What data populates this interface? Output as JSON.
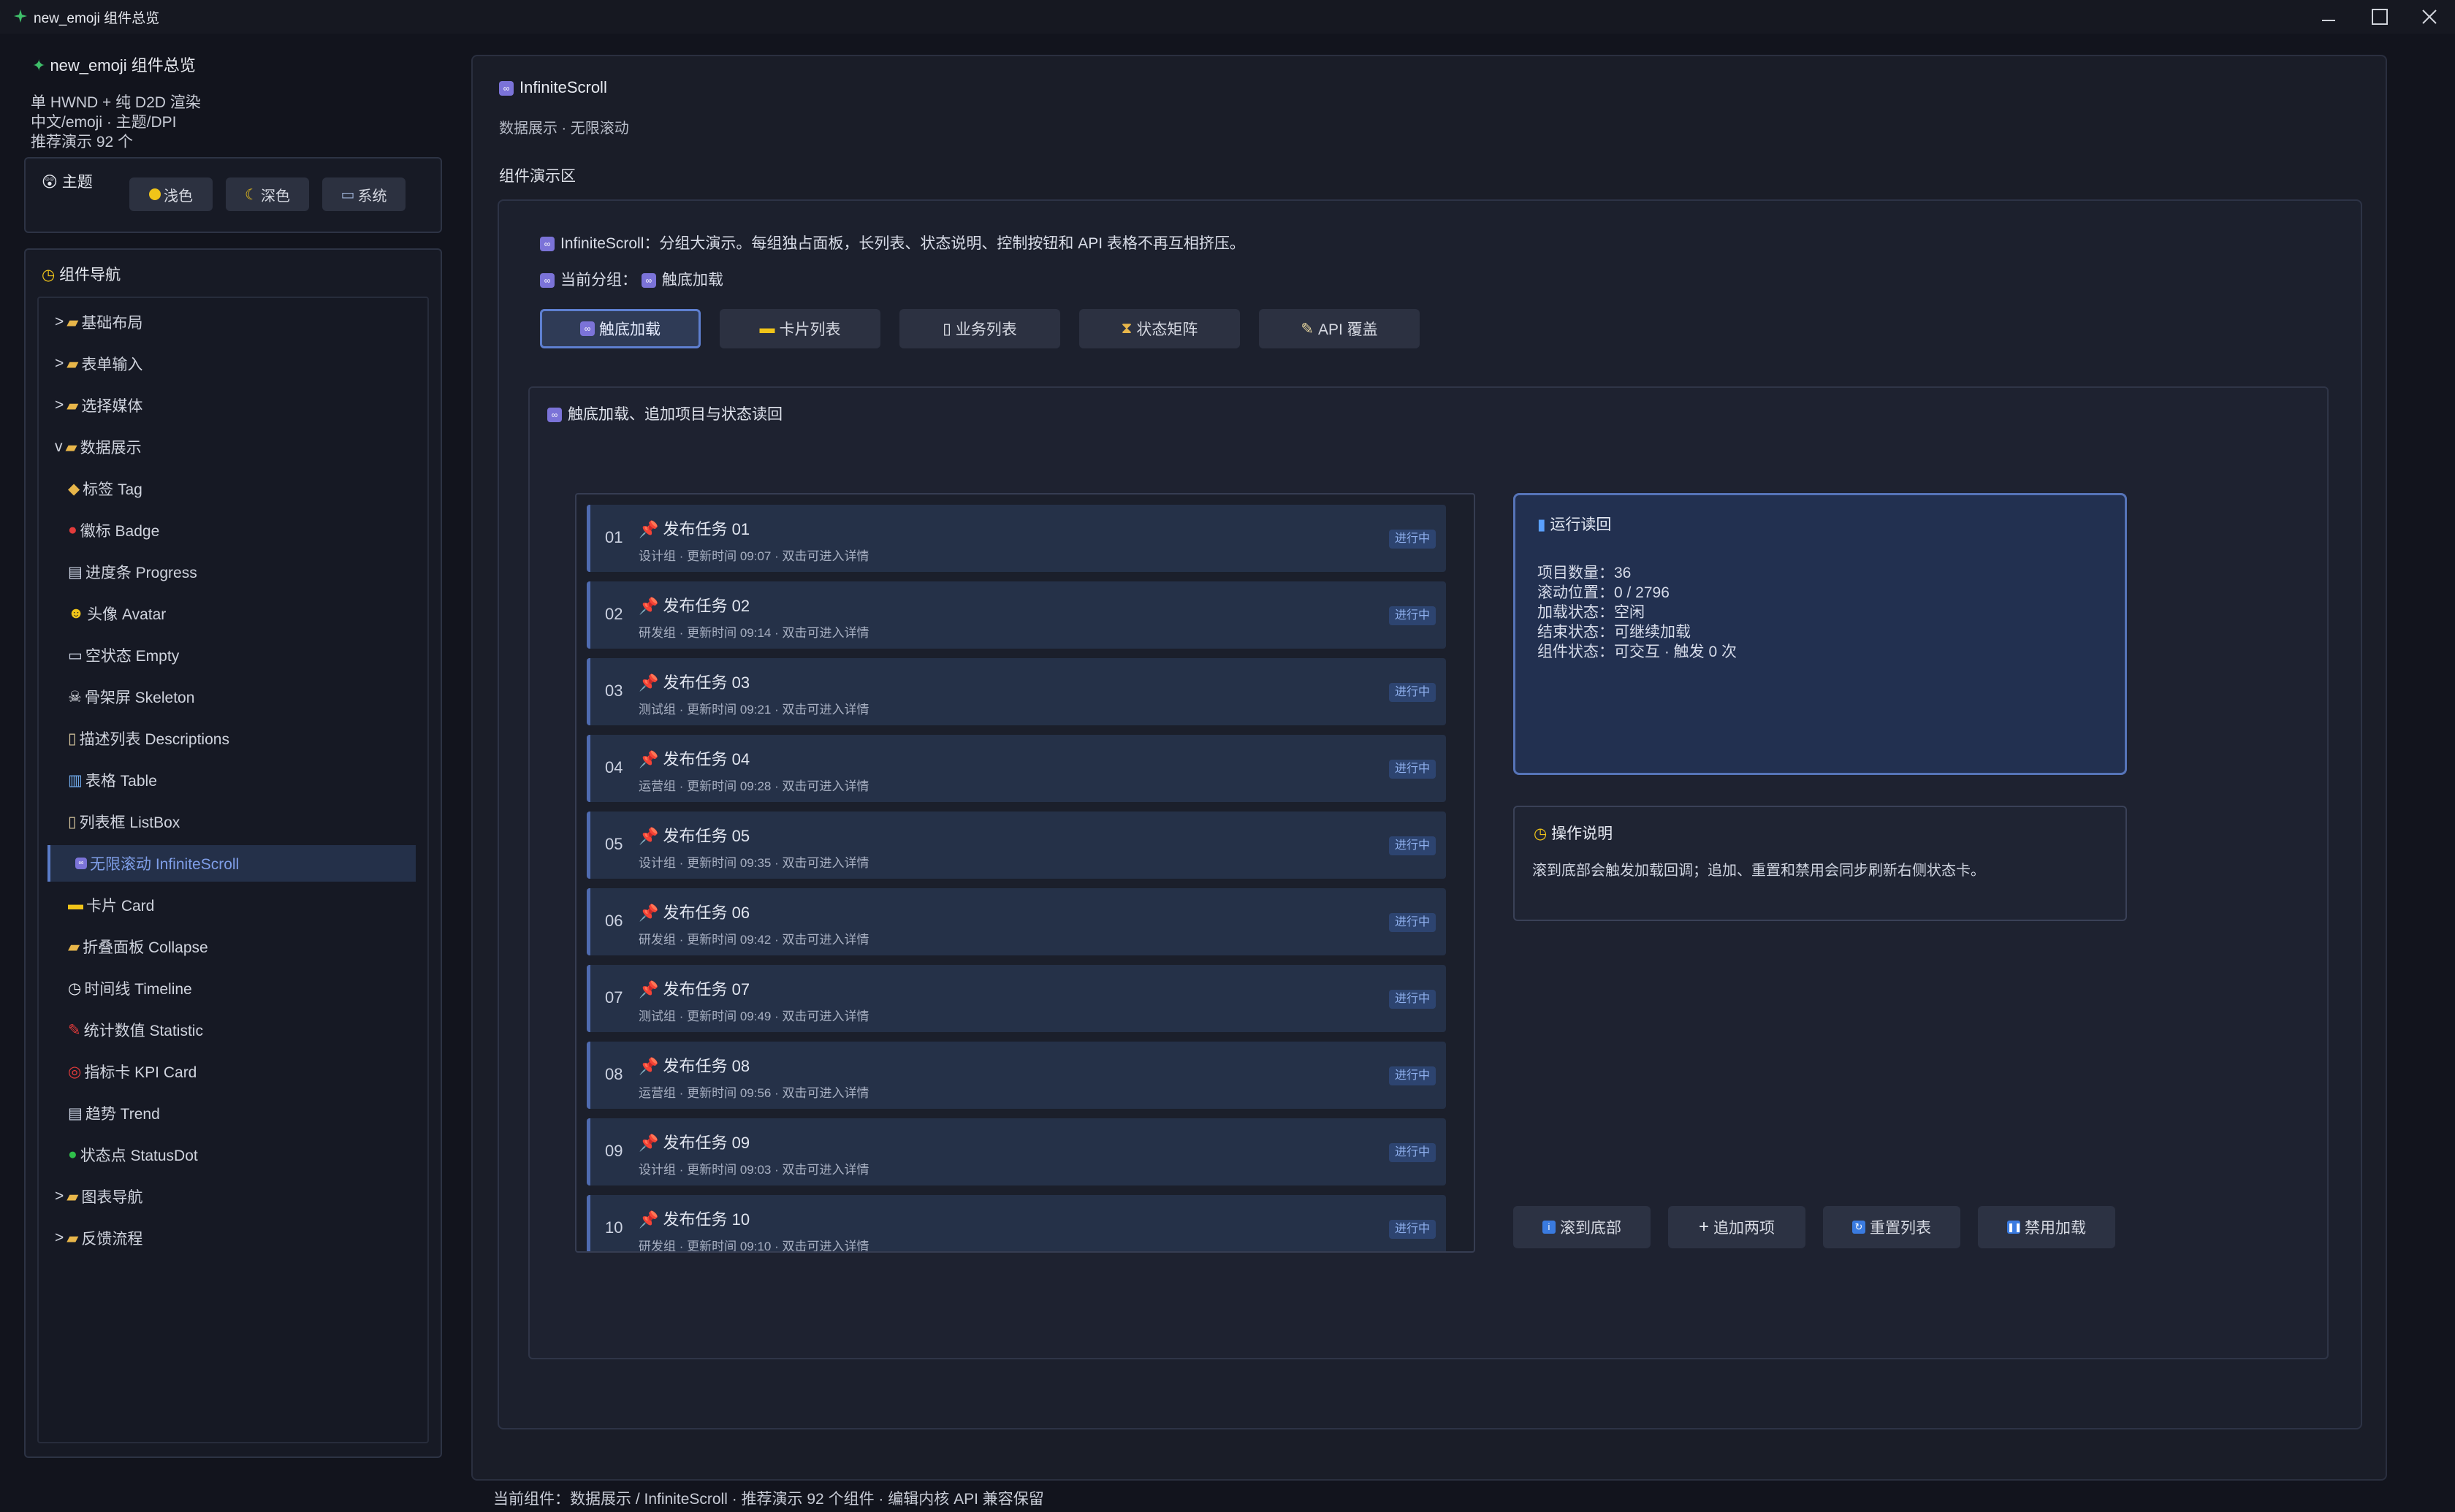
{
  "window": {
    "title": "new_emoji 组件总览"
  },
  "sidebar": {
    "brand": "new_emoji 组件总览",
    "info_lines": [
      "单 HWND + 纯 D2D 渲染",
      "中文/emoji · 主题/DPI",
      "推荐演示 92 个"
    ],
    "theme": {
      "title": "主题",
      "buttons": [
        {
          "icon": "sun-icon",
          "label": "浅色"
        },
        {
          "icon": "moon-icon",
          "label": "深色"
        },
        {
          "icon": "laptop-icon",
          "label": "系统"
        }
      ]
    },
    "nav": {
      "title": "组件导航",
      "items": [
        {
          "label": "基础布局",
          "prefix": ">",
          "type": "group",
          "icon": "folder-icon"
        },
        {
          "label": "表单输入",
          "prefix": ">",
          "type": "group",
          "icon": "folder-icon"
        },
        {
          "label": "选择媒体",
          "prefix": ">",
          "type": "group",
          "icon": "folder-icon"
        },
        {
          "label": "数据展示",
          "prefix": "v",
          "type": "group",
          "icon": "folder-icon"
        },
        {
          "label": "标签 Tag",
          "type": "child",
          "icon": "tag-icon"
        },
        {
          "label": "徽标 Badge",
          "type": "child",
          "icon": "red-dot-icon"
        },
        {
          "label": "进度条 Progress",
          "type": "child",
          "icon": "chart-icon"
        },
        {
          "label": "头像 Avatar",
          "type": "child",
          "icon": "smiley-icon"
        },
        {
          "label": "空状态 Empty",
          "type": "child",
          "icon": "inbox-icon"
        },
        {
          "label": "骨架屏 Skeleton",
          "type": "child",
          "icon": "skull-icon"
        },
        {
          "label": "描述列表 Descriptions",
          "type": "child",
          "icon": "document-icon"
        },
        {
          "label": "表格 Table",
          "type": "child",
          "icon": "bar-chart-icon"
        },
        {
          "label": "列表框 ListBox",
          "type": "child",
          "icon": "document-icon"
        },
        {
          "label": "无限滚动 InfiniteScroll",
          "type": "child",
          "icon": "infinity-icon",
          "active": true
        },
        {
          "label": "卡片 Card",
          "type": "child",
          "icon": "card-icon"
        },
        {
          "label": "折叠面板 Collapse",
          "type": "child",
          "icon": "folder-icon"
        },
        {
          "label": "时间线 Timeline",
          "type": "child",
          "icon": "clock-icon"
        },
        {
          "label": "统计数值 Statistic",
          "type": "child",
          "icon": "pin-icon"
        },
        {
          "label": "指标卡 KPI Card",
          "type": "child",
          "icon": "target-icon"
        },
        {
          "label": "趋势 Trend",
          "type": "child",
          "icon": "chart-icon"
        },
        {
          "label": "状态点 StatusDot",
          "type": "child",
          "icon": "green-dot-icon"
        },
        {
          "label": "图表导航",
          "prefix": ">",
          "type": "group",
          "icon": "folder-icon"
        },
        {
          "label": "反馈流程",
          "prefix": ">",
          "type": "group",
          "icon": "folder-icon"
        }
      ]
    }
  },
  "main": {
    "title": "InfiniteScroll",
    "subtitle": "数据展示 · 无限滚动",
    "demo_area_label": "组件演示区",
    "intro": "InfiniteScroll：分组大演示。每组独占面板，长列表、状态说明、控制按钮和 API 表格不再互相挤压。",
    "current_group_label": "当前分组：",
    "current_group_value": "触底加载",
    "tabs": [
      {
        "icon": "infinity-icon",
        "label": "触底加载",
        "active": true
      },
      {
        "icon": "card-icon",
        "label": "卡片列表"
      },
      {
        "icon": "page-icon",
        "label": "业务列表"
      },
      {
        "icon": "hourglass-icon",
        "label": "状态矩阵"
      },
      {
        "icon": "memo-icon",
        "label": "API 覆盖"
      }
    ],
    "section_title": "触底加载、追加项目与状态读回",
    "list": [
      {
        "index": "01",
        "title": "发布任务 01",
        "meta": "设计组 · 更新时间 09:07 · 双击可进入详情",
        "badge": "进行中"
      },
      {
        "index": "02",
        "title": "发布任务 02",
        "meta": "研发组 · 更新时间 09:14 · 双击可进入详情",
        "badge": "进行中"
      },
      {
        "index": "03",
        "title": "发布任务 03",
        "meta": "测试组 · 更新时间 09:21 · 双击可进入详情",
        "badge": "进行中"
      },
      {
        "index": "04",
        "title": "发布任务 04",
        "meta": "运营组 · 更新时间 09:28 · 双击可进入详情",
        "badge": "进行中"
      },
      {
        "index": "05",
        "title": "发布任务 05",
        "meta": "设计组 · 更新时间 09:35 · 双击可进入详情",
        "badge": "进行中"
      },
      {
        "index": "06",
        "title": "发布任务 06",
        "meta": "研发组 · 更新时间 09:42 · 双击可进入详情",
        "badge": "进行中"
      },
      {
        "index": "07",
        "title": "发布任务 07",
        "meta": "测试组 · 更新时间 09:49 · 双击可进入详情",
        "badge": "进行中"
      },
      {
        "index": "08",
        "title": "发布任务 08",
        "meta": "运营组 · 更新时间 09:56 · 双击可进入详情",
        "badge": "进行中"
      },
      {
        "index": "09",
        "title": "发布任务 09",
        "meta": "设计组 · 更新时间 09:03 · 双击可进入详情",
        "badge": "进行中"
      },
      {
        "index": "10",
        "title": "发布任务 10",
        "meta": "研发组 · 更新时间 09:10 · 双击可进入详情",
        "badge": "进行中"
      }
    ],
    "status": {
      "title": "运行读回",
      "lines": [
        "项目数量：36",
        "滚动位置：0 / 2796",
        "加载状态：空闲",
        "结束状态：可继续加载",
        "组件状态：可交互 · 触发 0 次"
      ]
    },
    "help": {
      "title": "操作说明",
      "text": "滚到底部会触发加载回调；追加、重置和禁用会同步刷新右侧状态卡。"
    },
    "actions": [
      {
        "icon": "info-icon",
        "label": "滚到底部"
      },
      {
        "icon": "plus-icon",
        "label": "追加两项"
      },
      {
        "icon": "refresh-icon",
        "label": "重置列表"
      },
      {
        "icon": "pause-icon",
        "label": "禁用加载"
      }
    ]
  },
  "footer": {
    "text": "当前组件：数据展示 / InfiniteScroll · 推荐演示 92 个组件 · 编辑内核 API 兼容保留"
  },
  "colors": {
    "background": "#12141d",
    "accent": "#5b7cc8",
    "badge_text": "#8fb0ee",
    "row_bg": "#253148"
  }
}
